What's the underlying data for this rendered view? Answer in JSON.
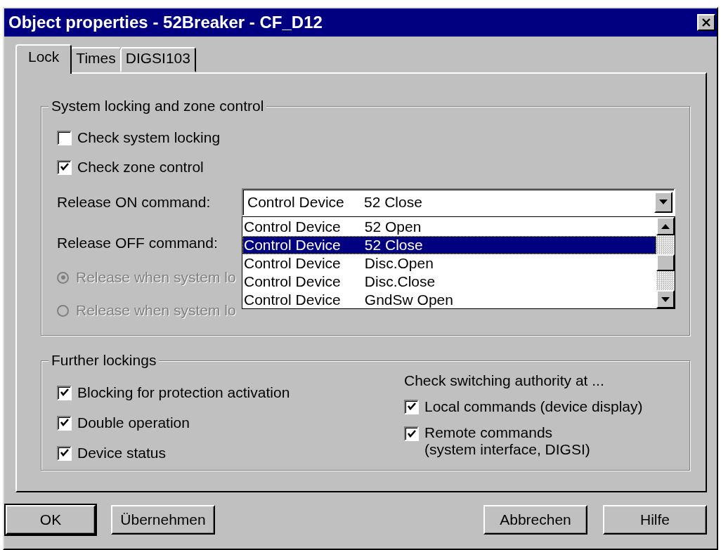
{
  "window": {
    "title": "Object properties - 52Breaker - CF_D12"
  },
  "tabs": [
    {
      "label": "Lock",
      "selected": true
    },
    {
      "label": "Times",
      "selected": false
    },
    {
      "label": "DIGSI103",
      "selected": false
    }
  ],
  "system_locking": {
    "title": "System locking and zone control",
    "checkboxes": [
      {
        "label": "Check system locking",
        "checked": false
      },
      {
        "label": "Check zone control",
        "checked": true
      }
    ],
    "release_on": {
      "label": "Release ON command:",
      "value_device": "Control Device",
      "value_command": "52 Close",
      "expanded": true
    },
    "release_off": {
      "label": "Release OFF command:"
    },
    "dropdown_list": [
      {
        "device": "Control Device",
        "command": "52 Open",
        "selected": false
      },
      {
        "device": "Control Device",
        "command": "52 Close",
        "selected": true
      },
      {
        "device": "Control Device",
        "command": "Disc.Open",
        "selected": false
      },
      {
        "device": "Control Device",
        "command": "Disc.Close",
        "selected": false
      },
      {
        "device": "Control Device",
        "command": "GndSw Open",
        "selected": false
      }
    ],
    "radios": [
      {
        "label": "Release when system lo",
        "selected": true,
        "disabled": true
      },
      {
        "label": "Release when system lo",
        "selected": false,
        "disabled": true
      }
    ]
  },
  "further_lockings": {
    "title": "Further lockings",
    "checkboxes": [
      {
        "label": "Blocking for protection activation",
        "checked": true
      },
      {
        "label": "Double operation",
        "checked": true
      },
      {
        "label": "Device status",
        "checked": true
      }
    ],
    "authority_title": "Check switching authority at ...",
    "authority_checkboxes": [
      {
        "label": "Local commands (device display)",
        "checked": true
      },
      {
        "label": "Remote commands",
        "sublabel": "(system interface, DIGSI)",
        "checked": true
      }
    ]
  },
  "buttons": [
    {
      "label": "OK",
      "default": true
    },
    {
      "label": "Übernehmen",
      "default": false
    },
    {
      "label": "Abbrechen",
      "default": false
    },
    {
      "label": "Hilfe",
      "default": false
    }
  ]
}
